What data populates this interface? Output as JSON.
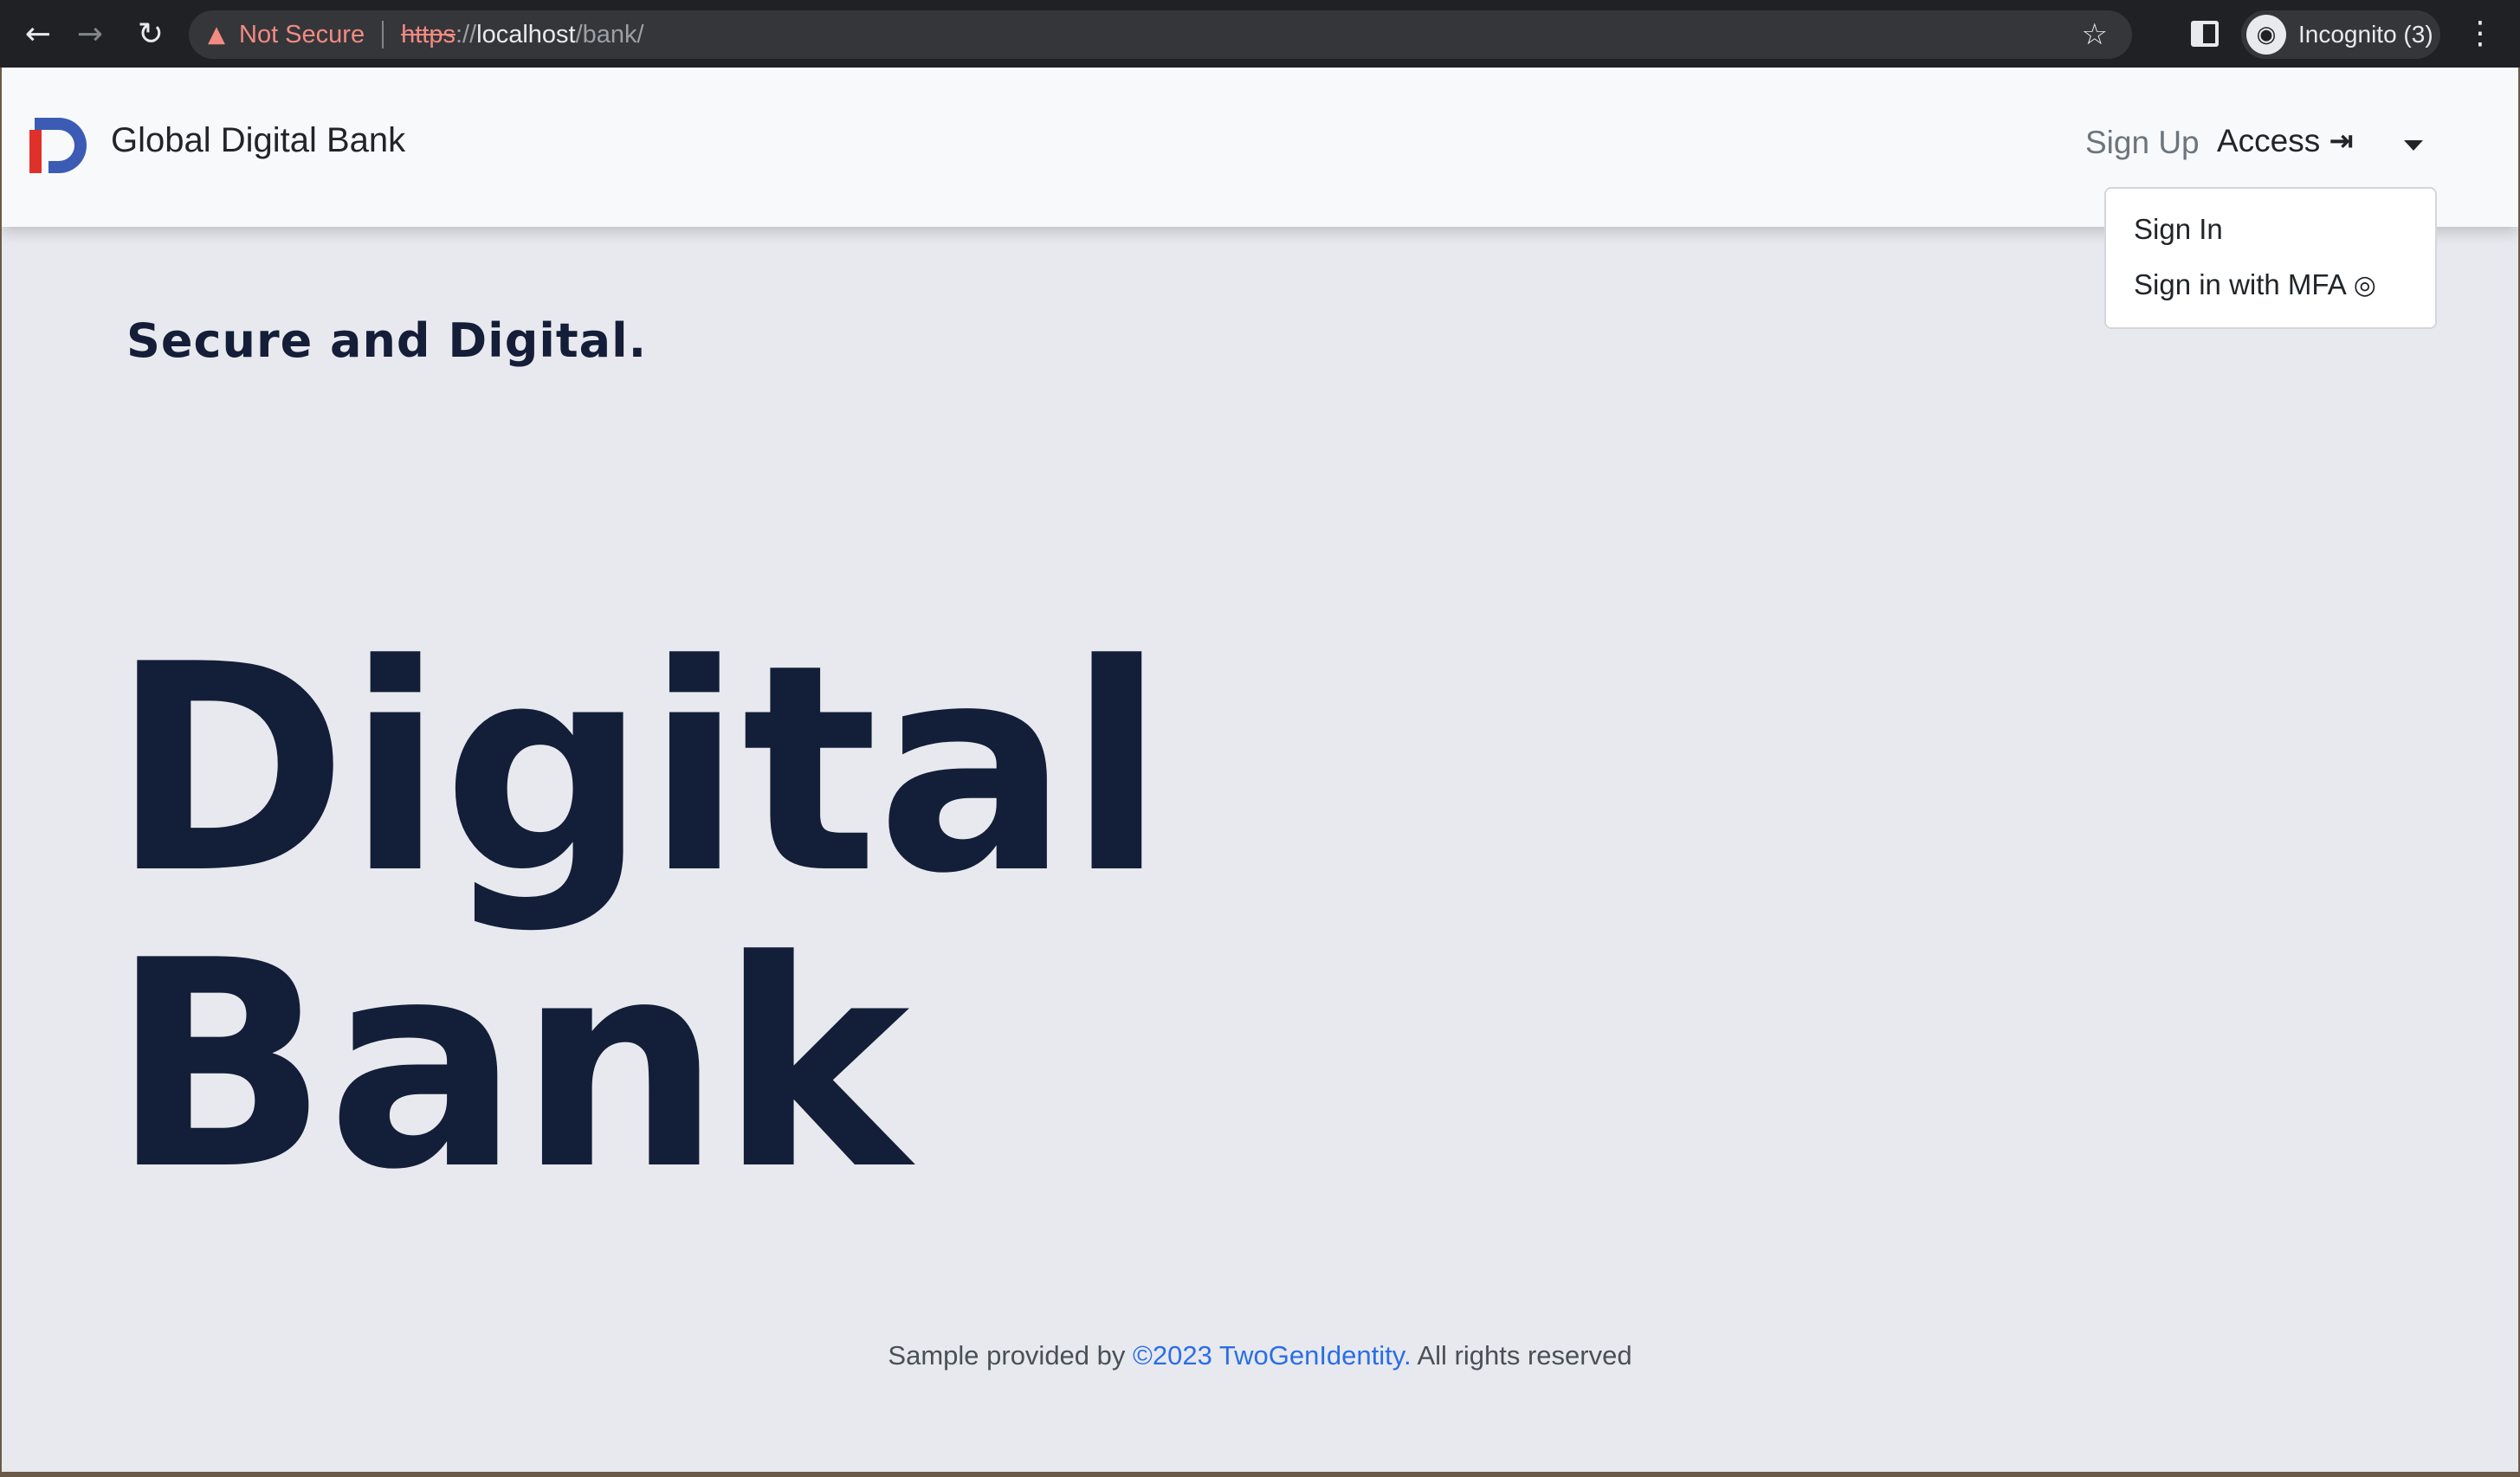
{
  "browser": {
    "security_label": "Not Secure",
    "url_scheme": "https",
    "url_scheme_sep": "://",
    "url_host": "localhost",
    "url_path": "/bank/",
    "profile_label": "Incognito (3)"
  },
  "navbar": {
    "brand": "Global Digital Bank",
    "signup_label": "Sign Up",
    "access_label": "Access",
    "dropdown": {
      "items": [
        {
          "label": "Sign In"
        },
        {
          "label": "Sign in with MFA"
        }
      ]
    }
  },
  "hero": {
    "tagline": "Secure and Digital.",
    "title_line1": "Digital",
    "title_line2": "Bank"
  },
  "footer": {
    "prefix": "Sample provided by ",
    "link_text": "©2023 TwoGenIdentity.",
    "suffix": " All rights reserved"
  },
  "colors": {
    "brand_red": "#e0302a",
    "brand_blue": "#3b5bb5",
    "hero_text": "#131f39",
    "link": "#2a6ee6"
  },
  "icons": [
    "back-arrow-icon",
    "forward-arrow-icon",
    "reload-icon",
    "warning-icon",
    "star-icon",
    "sidebar-icon",
    "incognito-icon",
    "kebab-menu-icon",
    "sign-in-icon",
    "caret-down-icon",
    "fingerprint-icon"
  ]
}
